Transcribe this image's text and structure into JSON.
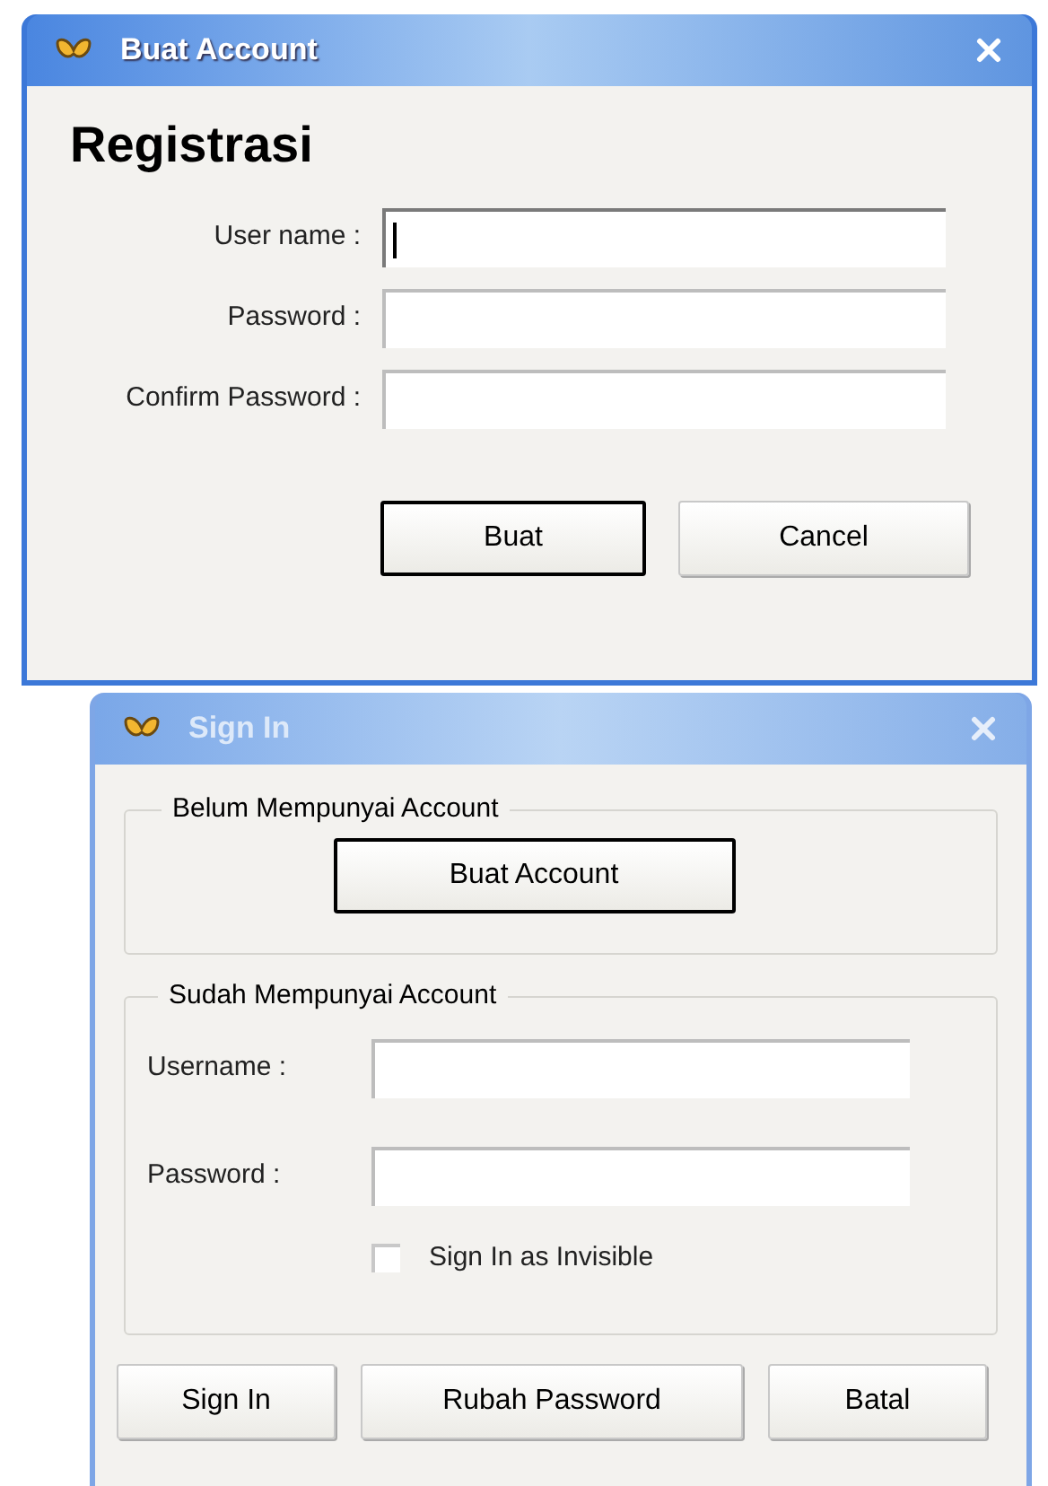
{
  "register_window": {
    "title": "Buat Account",
    "active": true,
    "heading": "Registrasi",
    "fields": [
      {
        "label": "User name :",
        "focused": true
      },
      {
        "label": "Password :",
        "focused": false
      },
      {
        "label": "Confirm Password :",
        "focused": false
      }
    ],
    "buttons": [
      {
        "label": "Buat",
        "default": true
      },
      {
        "label": "Cancel",
        "default": false
      }
    ]
  },
  "signin_window": {
    "title": "Sign In",
    "active": false,
    "new_account_group": {
      "legend": "Belum Mempunyai Account",
      "button": {
        "label": "Buat Account",
        "default": true
      }
    },
    "existing_account_group": {
      "legend": "Sudah Mempunyai Account",
      "fields": [
        {
          "label": "Username :",
          "focused": false
        },
        {
          "label": "Password :",
          "focused": false
        }
      ],
      "checkbox": {
        "label": "Sign In as Invisible",
        "checked": false
      }
    },
    "buttons": [
      {
        "label": "Sign In",
        "default": false
      },
      {
        "label": "Rubah Password",
        "default": false
      },
      {
        "label": "Batal",
        "default": false
      }
    ]
  }
}
